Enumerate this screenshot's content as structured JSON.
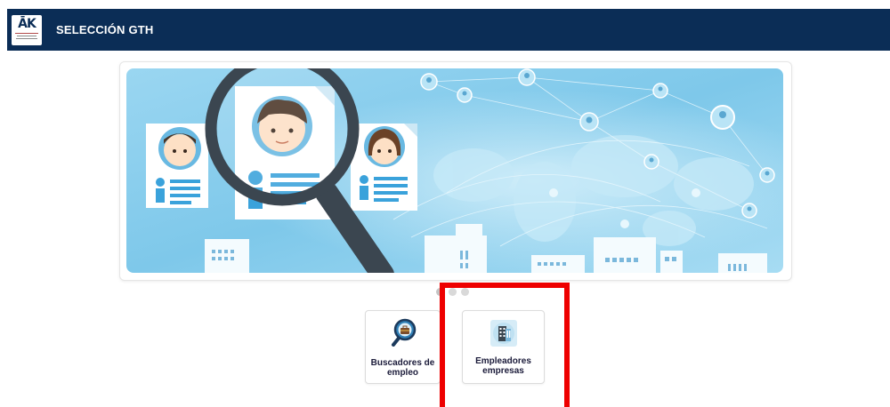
{
  "header": {
    "title": "SELECCIÓN GTH",
    "logo_text": "ĀK",
    "logo_icon": "institution-logo-icon"
  },
  "banner": {
    "image_icon": "recruitment-magnifier-illustration",
    "carousel_dots": 3,
    "active_dot": 1
  },
  "tiles": [
    {
      "label": "Buscadores de empleo",
      "icon": "briefcase-magnifier-icon"
    },
    {
      "label": "Empleadores empresas",
      "icon": "building-icon"
    }
  ],
  "colors": {
    "header_bg": "#0b2d56",
    "highlight": "#ee0000",
    "banner_sky": "#8fd0ee"
  }
}
